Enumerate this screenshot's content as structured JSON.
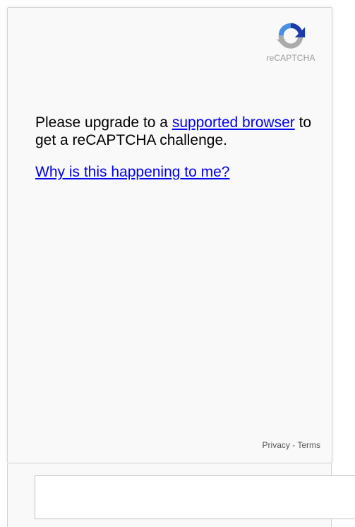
{
  "logo": {
    "icon": "recaptcha-logo-icon",
    "text": "reCAPTCHA"
  },
  "message": {
    "prefix": "Please upgrade to a ",
    "link_text": "supported browser",
    "suffix": " to get a reCAPTCHA challenge."
  },
  "why_link": "Why is this happening to me?",
  "footer": {
    "privacy": "Privacy",
    "separator": " - ",
    "terms": "Terms"
  },
  "response_field": {
    "value": ""
  },
  "colors": {
    "card_bg": "#f9f9f9",
    "link": "#0000ee",
    "logo_blue": "#4a90e2",
    "logo_dark_blue": "#1c3aa9",
    "logo_gray": "#ababab"
  }
}
